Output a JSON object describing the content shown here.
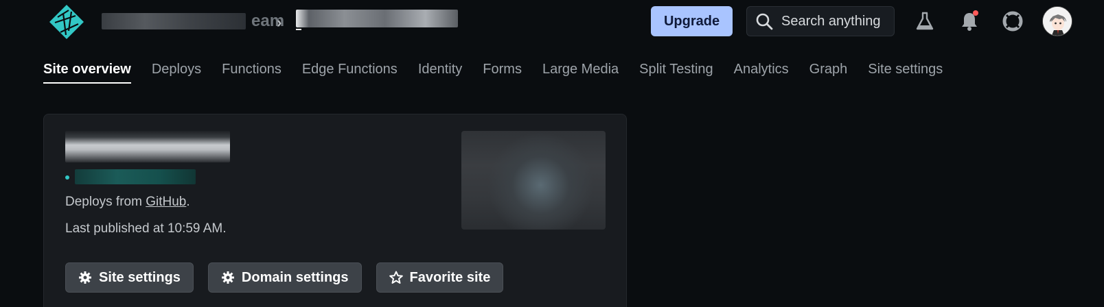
{
  "header": {
    "team_suffix": "eam",
    "breadcrumb_separator": "›",
    "upgrade_label": "Upgrade",
    "search_label": "Search anything",
    "accent": "#a9c4ff",
    "notification_dot_color": "#ff5a5a"
  },
  "tabs": [
    {
      "label": "Site overview",
      "active": true
    },
    {
      "label": "Deploys"
    },
    {
      "label": "Functions"
    },
    {
      "label": "Edge Functions"
    },
    {
      "label": "Identity"
    },
    {
      "label": "Forms"
    },
    {
      "label": "Large Media"
    },
    {
      "label": "Split Testing"
    },
    {
      "label": "Analytics"
    },
    {
      "label": "Graph"
    },
    {
      "label": "Site settings"
    }
  ],
  "card": {
    "deploys_prefix": "Deploys from ",
    "deploys_link": "GitHub",
    "deploys_suffix": ".",
    "published_text": "Last published at 10:59 AM.",
    "buttons": {
      "site_settings": "Site settings",
      "domain_settings": "Domain settings",
      "favorite_site": "Favorite site"
    },
    "url_dot_color": "#32c7c5"
  }
}
